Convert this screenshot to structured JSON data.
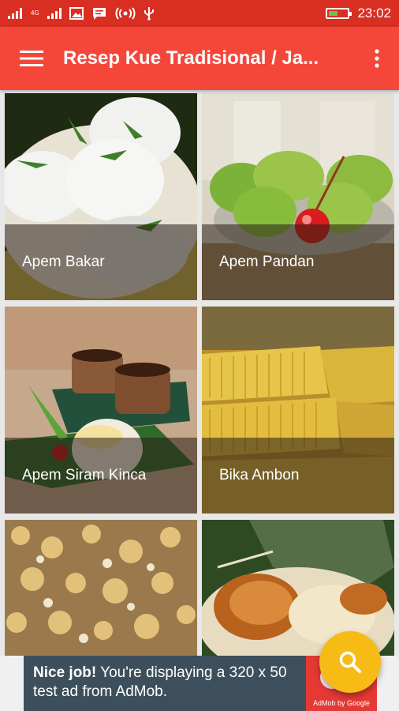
{
  "status_bar": {
    "network_label": "4G",
    "time": "23:02"
  },
  "toolbar": {
    "title": "Resep Kue Tradisional / Ja...",
    "menu_icon": "hamburger-menu-icon",
    "more_icon": "more-vertical-icon"
  },
  "recipes": [
    {
      "label": "Apem Bakar"
    },
    {
      "label": "Apem Pandan"
    },
    {
      "label": "Apem Siram Kinca"
    },
    {
      "label": "Bika Ambon"
    },
    {
      "label": ""
    },
    {
      "label": ""
    }
  ],
  "ad": {
    "bold_text": "Nice job!",
    "text": " You're displaying a 320 x 50 test ad from AdMob.",
    "logo_text": "AdMob by Google"
  },
  "fab": {
    "icon": "search-icon"
  },
  "colors": {
    "status_bar": "#d92e22",
    "toolbar": "#f4473a",
    "fab": "#f7bb16",
    "ad_background": "#3d4f5c"
  }
}
